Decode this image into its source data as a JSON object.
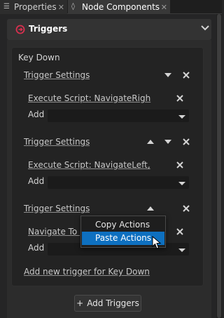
{
  "tabs": [
    {
      "label": "Properties",
      "icon": "list-icon"
    },
    {
      "label": "Node Components",
      "icon": "node-icon"
    }
  ],
  "panel": {
    "title": "Triggers"
  },
  "section": {
    "title": "Key Down",
    "triggers": [
      {
        "title": "Trigger Settings",
        "action": "Execute Script: NavigateRigh",
        "add": "Add"
      },
      {
        "title": "Trigger Settings",
        "action": "Execute Script: NavigateLeft,",
        "add": "Add"
      },
      {
        "title": "Trigger Settings",
        "action": "Navigate To Pa",
        "add": "Add"
      }
    ],
    "add_trigger": "Add new trigger for Key Down"
  },
  "footer": {
    "add_triggers": "Add Triggers"
  },
  "context_menu": {
    "items": [
      "Copy Actions",
      "Paste Actions"
    ],
    "highlighted": "Paste Actions"
  },
  "colors": {
    "accent": "#0e70c0",
    "trigger_icon": "#d9304f"
  }
}
